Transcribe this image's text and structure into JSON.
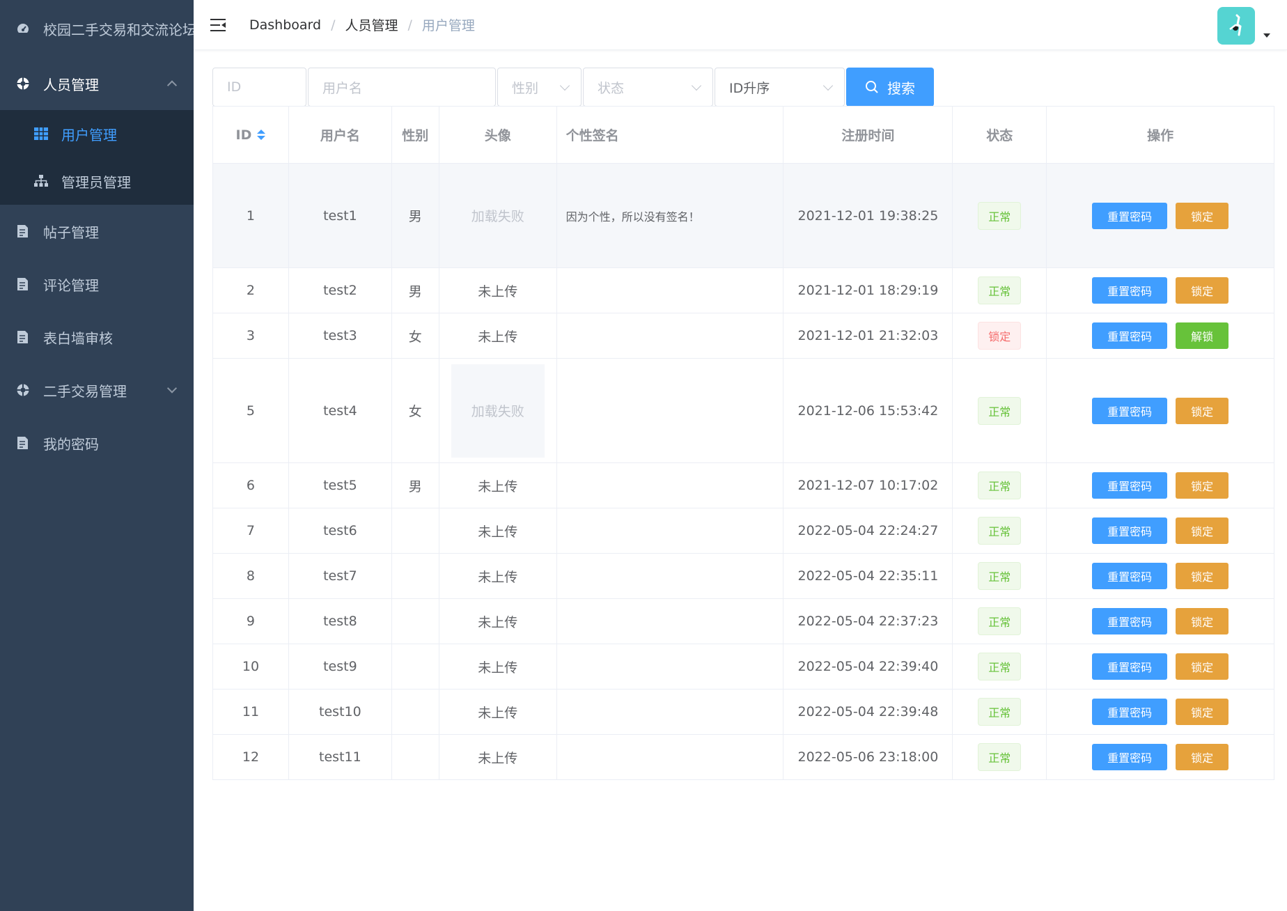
{
  "sidebar": {
    "title": "校园二手交易和交流论坛管",
    "menu": [
      {
        "label": "人员管理",
        "expanded": true,
        "children": [
          {
            "label": "用户管理",
            "active": true
          },
          {
            "label": "管理员管理",
            "active": false
          }
        ]
      },
      {
        "label": "帖子管理"
      },
      {
        "label": "评论管理"
      },
      {
        "label": "表白墙审核"
      },
      {
        "label": "二手交易管理",
        "expanded": false
      },
      {
        "label": "我的密码"
      }
    ],
    "colors": {
      "bg": "#304156",
      "submenu_bg": "#1f2d3d",
      "active": "#409eff"
    }
  },
  "header": {
    "breadcrumb": [
      "Dashboard",
      "人员管理",
      "用户管理"
    ],
    "separator": "/",
    "avatar_color": "#55d4d2"
  },
  "filters": {
    "id_placeholder": "ID",
    "username_placeholder": "用户名",
    "gender_placeholder": "性别",
    "status_placeholder": "状态",
    "sort_value": "ID升序",
    "search_label": "搜索"
  },
  "table": {
    "columns": [
      "ID",
      "用户名",
      "性别",
      "头像",
      "个性签名",
      "注册时间",
      "状态",
      "操作"
    ],
    "rows": [
      {
        "id": "1",
        "name": "test1",
        "gender": "男",
        "avatar": "加载失败",
        "avatar_state": "fail-plain",
        "sig": "因为个性，所以没有签名！",
        "time": "2021-12-01 19:38:25",
        "status": "正常",
        "locked": false,
        "tall": true,
        "hover": true
      },
      {
        "id": "2",
        "name": "test2",
        "gender": "男",
        "avatar": "未上传",
        "avatar_state": "none",
        "sig": "",
        "time": "2021-12-01 18:29:19",
        "status": "正常",
        "locked": false
      },
      {
        "id": "3",
        "name": "test3",
        "gender": "女",
        "avatar": "未上传",
        "avatar_state": "none",
        "sig": "",
        "time": "2021-12-01 21:32:03",
        "status": "锁定",
        "locked": true
      },
      {
        "id": "5",
        "name": "test4",
        "gender": "女",
        "avatar": "加载失败",
        "avatar_state": "fail",
        "sig": "",
        "time": "2021-12-06 15:53:42",
        "status": "正常",
        "locked": false,
        "tall": true
      },
      {
        "id": "6",
        "name": "test5",
        "gender": "男",
        "avatar": "未上传",
        "avatar_state": "none",
        "sig": "",
        "time": "2021-12-07 10:17:02",
        "status": "正常",
        "locked": false
      },
      {
        "id": "7",
        "name": "test6",
        "gender": "",
        "avatar": "未上传",
        "avatar_state": "none",
        "sig": "",
        "time": "2022-05-04 22:24:27",
        "status": "正常",
        "locked": false
      },
      {
        "id": "8",
        "name": "test7",
        "gender": "",
        "avatar": "未上传",
        "avatar_state": "none",
        "sig": "",
        "time": "2022-05-04 22:35:11",
        "status": "正常",
        "locked": false
      },
      {
        "id": "9",
        "name": "test8",
        "gender": "",
        "avatar": "未上传",
        "avatar_state": "none",
        "sig": "",
        "time": "2022-05-04 22:37:23",
        "status": "正常",
        "locked": false
      },
      {
        "id": "10",
        "name": "test9",
        "gender": "",
        "avatar": "未上传",
        "avatar_state": "none",
        "sig": "",
        "time": "2022-05-04 22:39:40",
        "status": "正常",
        "locked": false
      },
      {
        "id": "11",
        "name": "test10",
        "gender": "",
        "avatar": "未上传",
        "avatar_state": "none",
        "sig": "",
        "time": "2022-05-04 22:39:48",
        "status": "正常",
        "locked": false
      },
      {
        "id": "12",
        "name": "test11",
        "gender": "",
        "avatar": "未上传",
        "avatar_state": "none",
        "sig": "",
        "time": "2022-05-06 23:18:00",
        "status": "正常",
        "locked": false
      }
    ],
    "actions": {
      "reset": "重置密码",
      "lock": "锁定",
      "unlock": "解锁"
    }
  }
}
